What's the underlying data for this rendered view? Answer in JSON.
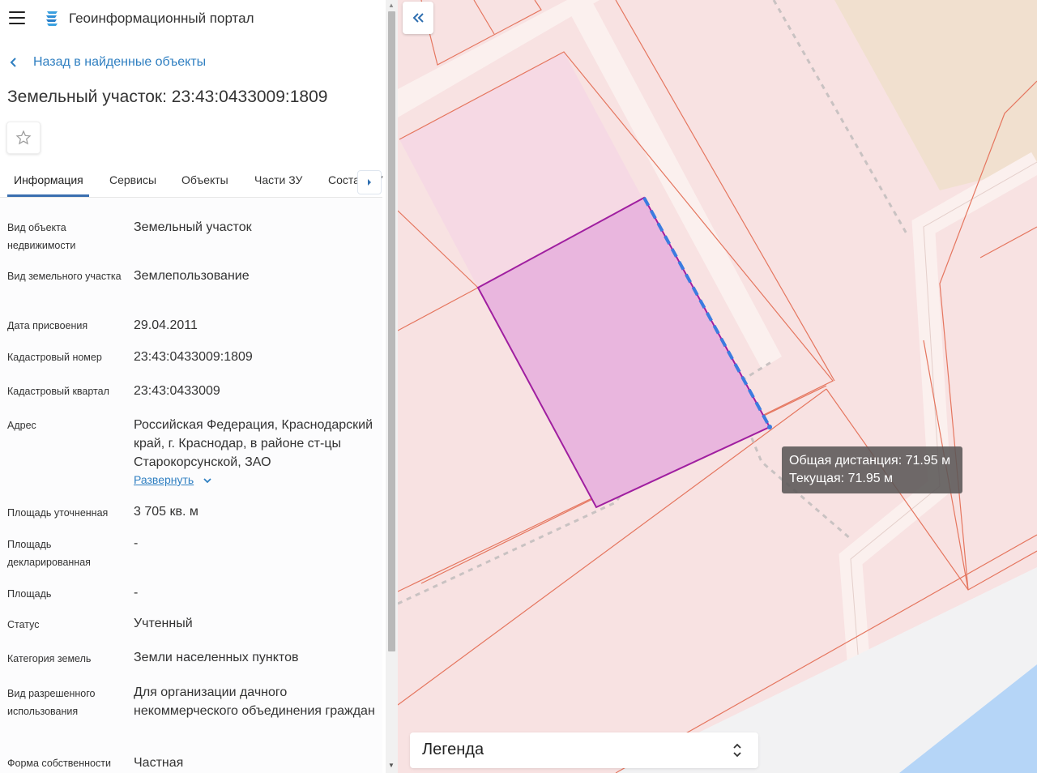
{
  "header": {
    "app_title": "Геоинформационный портал",
    "menu_icon": "hamburger-menu-icon",
    "logo_icon": "portal-logo-icon"
  },
  "nav": {
    "back_label": "Назад в найденные объекты"
  },
  "page_title": "Земельный участок: 23:43:0433009:1809",
  "tabs": [
    {
      "label": "Информация",
      "active": true
    },
    {
      "label": "Сервисы"
    },
    {
      "label": "Объекты"
    },
    {
      "label": "Части ЗУ"
    },
    {
      "label": "Состав ЗУ"
    }
  ],
  "info": [
    {
      "label": "Вид объекта недвижимости",
      "value": "Земельный участок"
    },
    {
      "label": "Вид земельного участка",
      "value": "Землепользование"
    },
    {
      "label": "Дата присвоения",
      "value": "29.04.2011"
    },
    {
      "label": "Кадастровый номер",
      "value": "23:43:0433009:1809"
    },
    {
      "label": "Кадастровый квартал",
      "value": "23:43:0433009"
    },
    {
      "label": "Адрес",
      "value": "Российская Федерация, Краснодарский край, г. Краснодар, в районе ст-цы Старокорсунской, ЗАО"
    },
    {
      "label": "Площадь уточненная",
      "value": "3 705 кв. м"
    },
    {
      "label": "Площадь декларированная",
      "value": "-"
    },
    {
      "label": "Площадь",
      "value": "-"
    },
    {
      "label": "Статус",
      "value": "Учтенный"
    },
    {
      "label": "Категория земель",
      "value": "Земли населенных пунктов"
    },
    {
      "label": "Вид разрешенного использования",
      "value": "Для организации дачного некоммерческого объединения граждан"
    },
    {
      "label": "Форма собственности",
      "value": "Частная"
    }
  ],
  "address_expand_label": "Развернуть",
  "map": {
    "tooltip": {
      "total": "Общая дистанция: 71.95 м",
      "current": "Текущая: 71.95 м"
    },
    "legend_label": "Легенда",
    "colors": {
      "parcel_fill": "#e9b6de",
      "parcel_stroke": "#a01fa0",
      "boundary": "#e5765f",
      "measure_line": "#3b7be0",
      "water": "#b5d5f7",
      "sand": "#f1e0cf",
      "accent": "#2f7fc1"
    }
  }
}
